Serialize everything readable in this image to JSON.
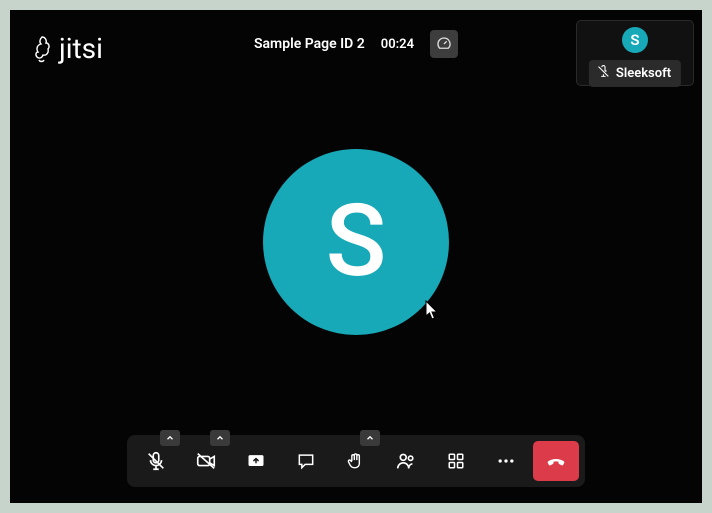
{
  "brand": {
    "name": "jitsi"
  },
  "header": {
    "room_title": "Sample Page ID 2",
    "timer": "00:24"
  },
  "participant_thumb": {
    "initial": "S",
    "name": "Sleeksoft",
    "muted": true
  },
  "stage": {
    "initial": "S"
  },
  "toolbar": {
    "mic": {
      "muted": true
    },
    "camera": {
      "off": true
    },
    "screenshare": "screenshare",
    "chat": "chat",
    "raisehand": "raisehand",
    "participants": "participants",
    "tiles": "tiles",
    "more": "more",
    "hangup": "hangup"
  },
  "accent": "#17a9b7",
  "hangup_color": "#dc3b4a"
}
